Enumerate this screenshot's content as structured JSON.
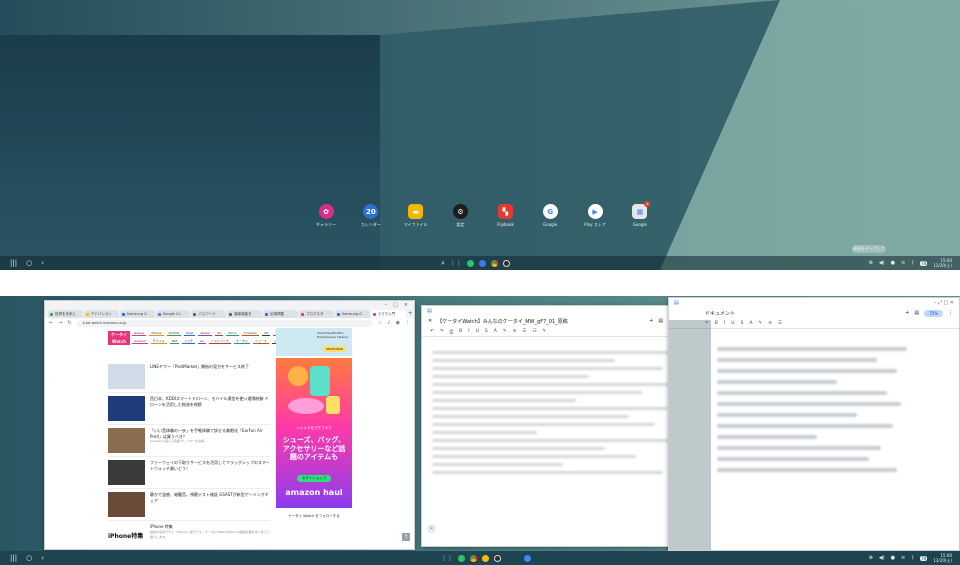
{
  "home": {
    "apps": [
      {
        "label": "ギャラリー",
        "icon": "gallery-icon",
        "color": "#d92d8a",
        "glyph": "✿",
        "shape": "round"
      },
      {
        "label": "カレンダー",
        "icon": "calendar-icon",
        "color": "#2e6fd6",
        "glyph": "20",
        "shape": "round"
      },
      {
        "label": "マイファイル",
        "icon": "folder-icon",
        "color": "#f2b705",
        "glyph": "▬",
        "shape": "sq"
      },
      {
        "label": "設定",
        "icon": "settings-gear-icon",
        "color": "#1d1d1d",
        "glyph": "⚙",
        "shape": "round"
      },
      {
        "label": "Flipbook",
        "icon": "flipboard-icon",
        "color": "#e53935",
        "glyph": "▚",
        "shape": "sq"
      },
      {
        "label": "Google",
        "icon": "google-icon",
        "color": "#ffffff",
        "glyph": "G",
        "shape": "round"
      },
      {
        "label": "Play ストア",
        "icon": "play-store-icon",
        "color": "#ffffff",
        "glyph": "▶",
        "shape": "round"
      },
      {
        "label": "Google",
        "icon": "google-folder-icon",
        "color": "#e6e6e6",
        "glyph": "▦",
        "shape": "sq",
        "badge": "3"
      }
    ],
    "edit_button": "画面をタップして"
  },
  "taskbar": {
    "time": "15:00",
    "date": "12/20(土)",
    "battery": "70"
  },
  "chrome": {
    "tabs": [
      {
        "label": "投資を未来に",
        "color": "#34a853"
      },
      {
        "label": "アドバンスト",
        "color": "#fbbc05"
      },
      {
        "label": "Samsung G",
        "color": "#1a73e8"
      },
      {
        "label": "Google Ch",
        "color": "#4285f4"
      },
      {
        "label": "パスワード",
        "color": "#5f6368"
      },
      {
        "label": "最新機能を",
        "color": "#5f6368"
      },
      {
        "label": "記事掲載",
        "color": "#1a73e8"
      },
      {
        "label": "ブログスタ",
        "color": "#ea4335"
      },
      {
        "label": "Samsung G",
        "color": "#1a73e8"
      },
      {
        "label": "スマホ入門",
        "color": "#e8357a",
        "active": true
      }
    ],
    "url": "k-tai.watch.impress.co.jp",
    "site_logo": "ケータイ Watch",
    "categories": [
      "Galaxy",
      "iPhone",
      "AQUOS",
      "Pixel",
      "Xperia",
      "AU",
      "IIJmio",
      "Y!mobile",
      "UQ",
      "楽天",
      "Android",
      "モバイル",
      "SIM",
      "ドコモ",
      "au",
      "ソフトバンク",
      "ケータイ",
      "ニュース",
      "レビュー"
    ],
    "articles": [
      {
        "title": "LINEヤフー「PostMarket」開始の見方をサービス終了",
        "sub": "",
        "thumb": "#cfdbe6"
      },
      {
        "title": "西日本、KDDIスマートドローン、モバイル通信を使い遠隔制御 ドローンを活用した物流を視野",
        "sub": "",
        "thumb": "#1f3b7a"
      },
      {
        "title": "「いい音体験の一歩」を手軽体験で試せる美眼化「EarFun Air Pro4」は買うべき？",
        "sub": "Amazonで買える音楽プレーヤーもお得",
        "thumb": "#8a6d4f"
      },
      {
        "title": "ファーウェイの下取りサービスを活用してフラッグシップのスマートウォッチ買いどう！",
        "sub": "",
        "thumb": "#3a3a3a"
      },
      {
        "title": "静かで温感、暗騒音。視聴テスト検証 GSASTが新型ゲーミングチェア",
        "sub": "",
        "thumb": "#6b4a3a"
      },
      {
        "title": "iPhone 特集",
        "sub": "最新の注目モデル「iPhone」新モデル。ケータイWatchのiPhone関連記事をまとめてご紹介します。",
        "thumb": "#ffffff",
        "thumb_text": "iPhone特集"
      }
    ],
    "ad_small": {
      "text": "OuterHeadPodPro Headphones Cleaner",
      "cta": "SHOP NOW"
    },
    "ad_big": {
      "lead": "トレンドをプチプラで",
      "copy": "シューズ、バッグ、アクセサリーなど話題のアイテムも",
      "cta": "今すぐショップ",
      "brand": "amazon haul"
    },
    "follow": "ケータイ Watch をフォローする"
  },
  "doc1": {
    "title": "【ケータイWatch】みんなのケータイ_MW_gF7_01_原稿",
    "zoom": "75%",
    "toolbar": [
      "↶",
      "↷",
      "⎙",
      "B",
      "I",
      "U",
      "S",
      "A",
      "✎",
      "≡",
      "☰",
      "☷",
      "✎"
    ]
  },
  "doc2": {
    "title": "ドキュメント",
    "zoom": "75%"
  }
}
